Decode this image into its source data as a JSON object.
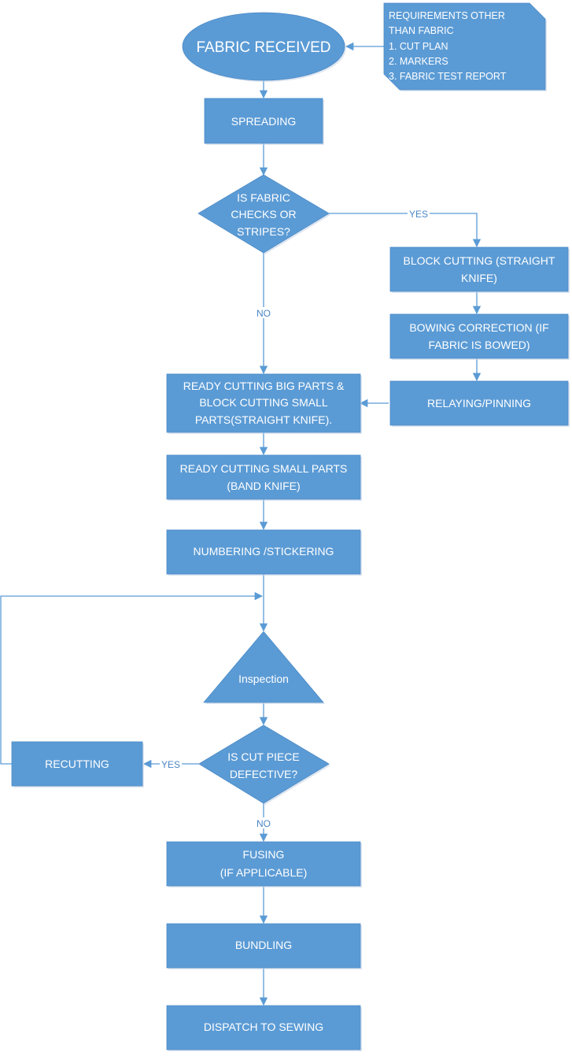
{
  "diagram": {
    "theme": {
      "shape_fill": "#5b9bd5",
      "text_color": "#ffffff",
      "label_color": "#4a86c5"
    },
    "nodes": {
      "fabric_received": {
        "type": "terminator",
        "lines": [
          "FABRIC RECEIVED"
        ]
      },
      "requirements_note": {
        "type": "note",
        "lines": [
          "REQUIREMENTS OTHER",
          "THAN FABRIC",
          "1. CUT PLAN",
          "2. MARKERS",
          "3. FABRIC TEST REPORT"
        ]
      },
      "spreading": {
        "type": "process",
        "lines": [
          "SPREADING"
        ]
      },
      "decision_checks": {
        "type": "decision",
        "lines": [
          "IS FABRIC",
          "CHECKS OR",
          "STRIPES?"
        ]
      },
      "block_cutting": {
        "type": "process",
        "lines": [
          "BLOCK CUTTING (STRAIGHT",
          "KNIFE)"
        ]
      },
      "bowing_correction": {
        "type": "process",
        "lines": [
          "BOWING CORRECTION (IF",
          "FABRIC IS BOWED)"
        ]
      },
      "relaying": {
        "type": "process",
        "lines": [
          "RELAYING/PINNING"
        ]
      },
      "ready_cutting_big": {
        "type": "process",
        "lines": [
          "READY CUTTING BIG PARTS  &",
          "BLOCK CUTTING SMALL",
          "PARTS(STRAIGHT KNIFE)."
        ]
      },
      "ready_cutting_small": {
        "type": "process",
        "lines": [
          "READY CUTTING SMALL PARTS",
          "(BAND KNIFE)"
        ]
      },
      "numbering": {
        "type": "process",
        "lines": [
          "NUMBERING /STICKERING"
        ]
      },
      "inspection": {
        "type": "merge",
        "lines": [
          "Inspection"
        ]
      },
      "decision_defective": {
        "type": "decision",
        "lines": [
          "IS CUT PIECE",
          "DEFECTIVE?"
        ]
      },
      "recutting": {
        "type": "process",
        "lines": [
          "RECUTTING"
        ]
      },
      "fusing": {
        "type": "process",
        "lines": [
          "FUSING",
          "(IF APPLICABLE)"
        ]
      },
      "bundling": {
        "type": "process",
        "lines": [
          "BUNDLING"
        ]
      },
      "dispatch": {
        "type": "process",
        "lines": [
          "DISPATCH TO SEWING"
        ]
      }
    },
    "edge_labels": {
      "checks_yes": "YES",
      "checks_no": "NO",
      "defective_yes": "YES",
      "defective_no": "NO"
    }
  }
}
